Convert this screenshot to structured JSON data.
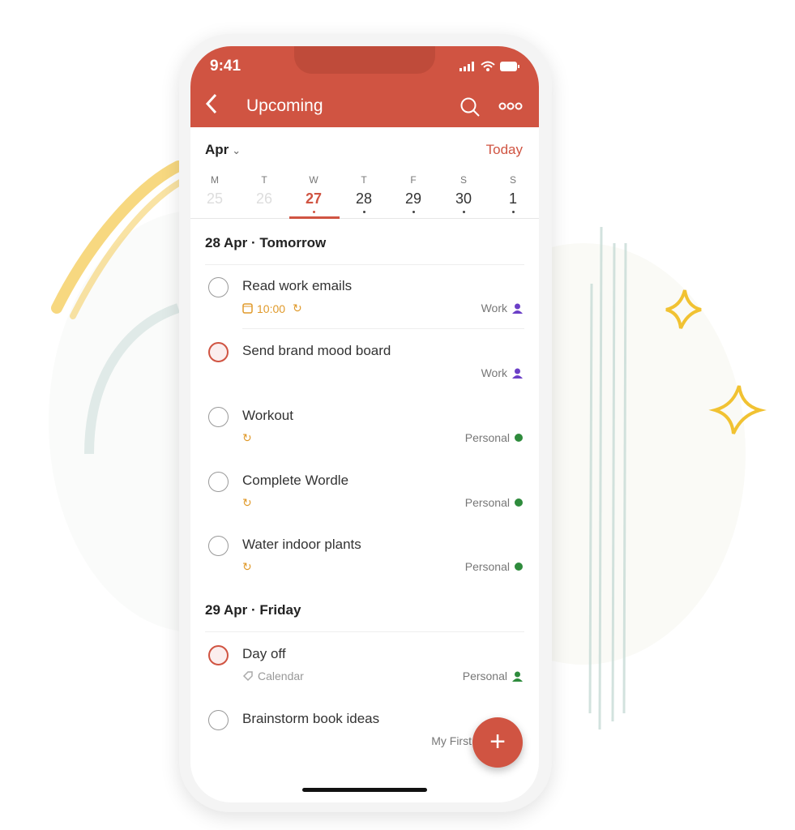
{
  "colors": {
    "accent": "#d05442",
    "work": "#6b3fc7",
    "personal": "#2e8b3c",
    "due": "#e09a2b"
  },
  "status_bar": {
    "time": "9:41"
  },
  "header": {
    "title": "Upcoming"
  },
  "calendar": {
    "month": "Apr",
    "today_label": "Today",
    "days": [
      {
        "letter": "M",
        "num": "25"
      },
      {
        "letter": "T",
        "num": "26"
      },
      {
        "letter": "W",
        "num": "27"
      },
      {
        "letter": "T",
        "num": "28"
      },
      {
        "letter": "F",
        "num": "29"
      },
      {
        "letter": "S",
        "num": "30"
      },
      {
        "letter": "S",
        "num": "1"
      }
    ]
  },
  "sections": [
    {
      "title": "28 Apr · Tomorrow",
      "tasks": [
        {
          "name": "Read work emails",
          "time": "10:00",
          "project": "Work"
        },
        {
          "name": "Send brand mood board",
          "project": "Work"
        },
        {
          "name": "Workout",
          "project": "Personal"
        },
        {
          "name": "Complete Wordle",
          "project": "Personal"
        },
        {
          "name": "Water indoor plants",
          "project": "Personal"
        }
      ]
    },
    {
      "title": "29 Apr · Friday",
      "tasks": [
        {
          "name": "Day off",
          "label": "Calendar",
          "project": "Personal"
        },
        {
          "name": "Brainstorm book ideas",
          "project": "My First Bo"
        }
      ]
    }
  ],
  "fab": {
    "label": "+"
  }
}
